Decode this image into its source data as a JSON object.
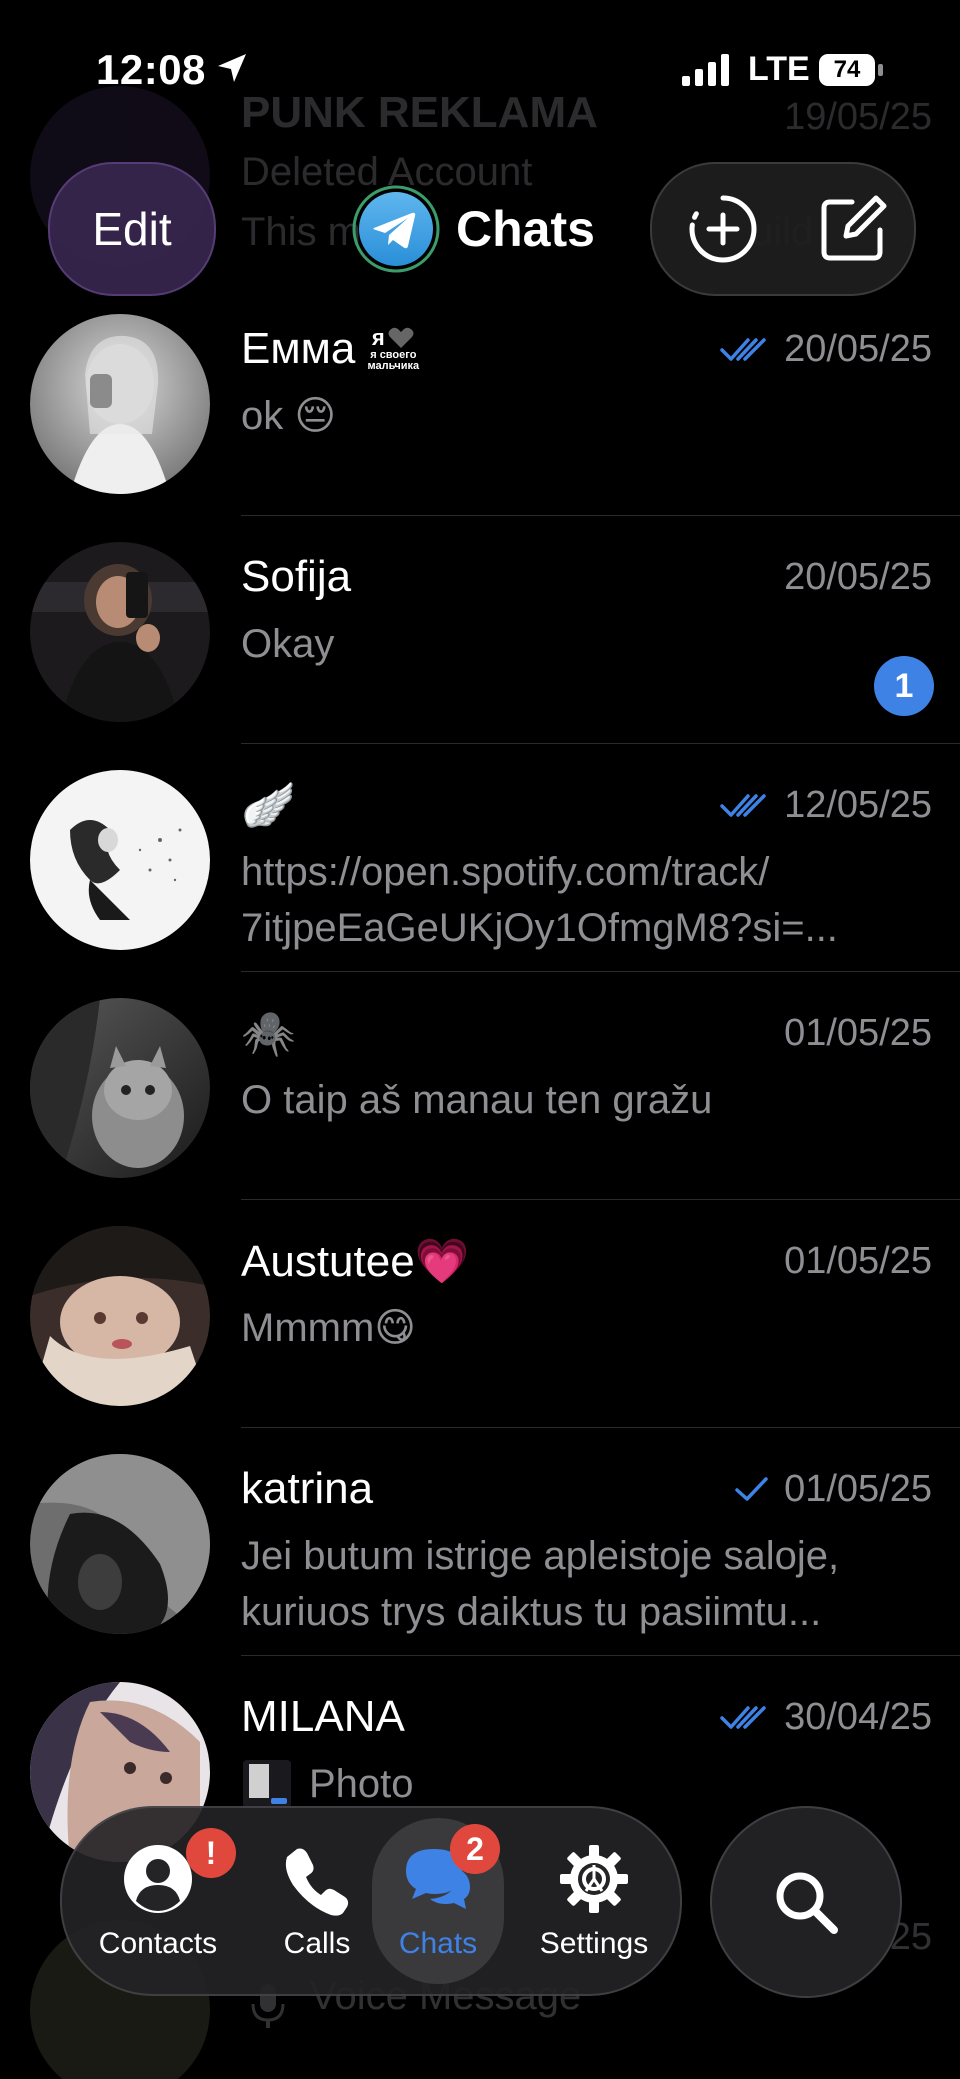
{
  "status_bar": {
    "time": "12:08",
    "network": "LTE",
    "battery": "74"
  },
  "header": {
    "edit_label": "Edit",
    "title": "Chats"
  },
  "ghost_top": {
    "name": "PUNK REKLAMA",
    "line1": "Deleted Account",
    "line2": "This m",
    "line2_tail": "uild",
    "date": "19/05/25"
  },
  "chats": [
    {
      "name": "Емма",
      "name_suffix": "я своего мальчика",
      "date": "20/05/25",
      "preview": "ok 😔",
      "status": "read",
      "unread": ""
    },
    {
      "name": "Sofija",
      "name_suffix": "",
      "date": "20/05/25",
      "preview": "Okay",
      "status": "none",
      "unread": "1"
    },
    {
      "name": "🪽",
      "name_suffix": "",
      "date": "12/05/25",
      "preview": "https://open.spotify.com/track/\n7itjpeEaGeUKjOy1OfmgM8?si=...",
      "status": "read",
      "unread": ""
    },
    {
      "name": "🕷️",
      "name_suffix": "",
      "date": "01/05/25",
      "preview": "O taip aš manau ten gražu",
      "status": "none",
      "unread": ""
    },
    {
      "name": "Austutee💗",
      "name_suffix": "",
      "date": "01/05/25",
      "preview": "Mmmm😋",
      "status": "none",
      "unread": ""
    },
    {
      "name": "katrina",
      "name_suffix": "",
      "date": "01/05/25",
      "preview": "Jei butum istrige apleistoje saloje,\nkuriuos trys daiktus tu pasiimtu...",
      "status": "sent",
      "unread": ""
    },
    {
      "name": "MILANA",
      "name_suffix": "",
      "date": "30/04/25",
      "preview": "Photo",
      "status": "read",
      "unread": ""
    }
  ],
  "ghost_bottom": {
    "name": "",
    "date": "25",
    "preview": "Voice Message"
  },
  "tabs": [
    {
      "label": "Contacts",
      "badge": "!"
    },
    {
      "label": "Calls",
      "badge": ""
    },
    {
      "label": "Chats",
      "badge": "2"
    },
    {
      "label": "Settings",
      "badge": ""
    }
  ],
  "colors": {
    "accent": "#3f82e5",
    "badge_red": "#e0483e",
    "secondary_text": "#8e8e93"
  }
}
